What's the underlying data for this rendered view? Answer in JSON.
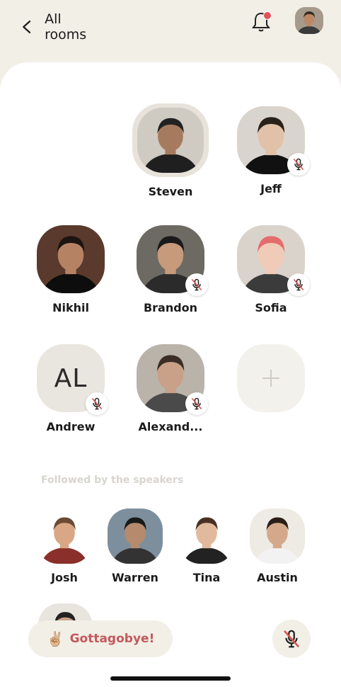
{
  "header": {
    "back_label": "All rooms",
    "notification_color": "#e2535a"
  },
  "speakers": [
    {
      "name": "Steven",
      "muted": false,
      "active": true
    },
    {
      "name": "Jeff",
      "muted": true
    },
    {
      "name": "Nikhil",
      "muted": false
    },
    {
      "name": "Brandon",
      "muted": true
    },
    {
      "name": "Sofia",
      "muted": true
    },
    {
      "name": "Andrew",
      "initials": "AL",
      "muted": true
    },
    {
      "name": "Alexand...",
      "muted": true
    }
  ],
  "followed_section": {
    "label": "Followed by the speakers"
  },
  "listeners": [
    {
      "name": "Josh"
    },
    {
      "name": "Warren"
    },
    {
      "name": "Tina"
    },
    {
      "name": "Austin"
    }
  ],
  "footer": {
    "leave_emoji": "✌🏼",
    "leave_label": "Gottagobye!",
    "accent": "#c4595c",
    "background": "#f2efe7"
  }
}
